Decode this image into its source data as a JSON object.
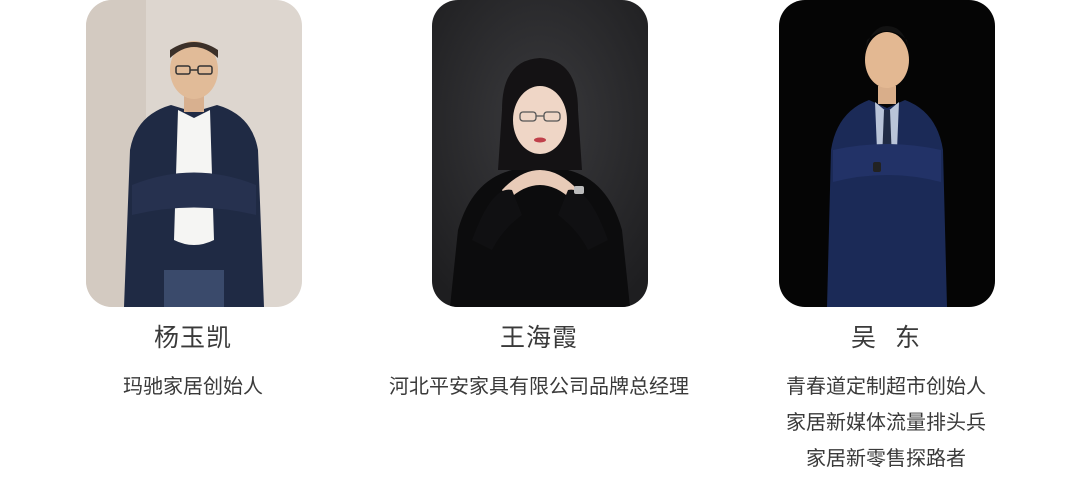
{
  "people": [
    {
      "name": "杨玉凯",
      "titles": [
        "玛驰家居创始人"
      ]
    },
    {
      "name": "王海霞",
      "titles": [
        "河北平安家具有限公司品牌总经理"
      ]
    },
    {
      "name": "吴  东",
      "titles": [
        "青春道定制超市创始人",
        "家居新媒体流量排头兵",
        "家居新零售探路者"
      ]
    }
  ],
  "colors": {
    "text": "#3a3a3a",
    "photo1_bg": "#ddd6cf",
    "photo2_bg": "#2a2a2c",
    "photo3_bg": "#050505"
  }
}
